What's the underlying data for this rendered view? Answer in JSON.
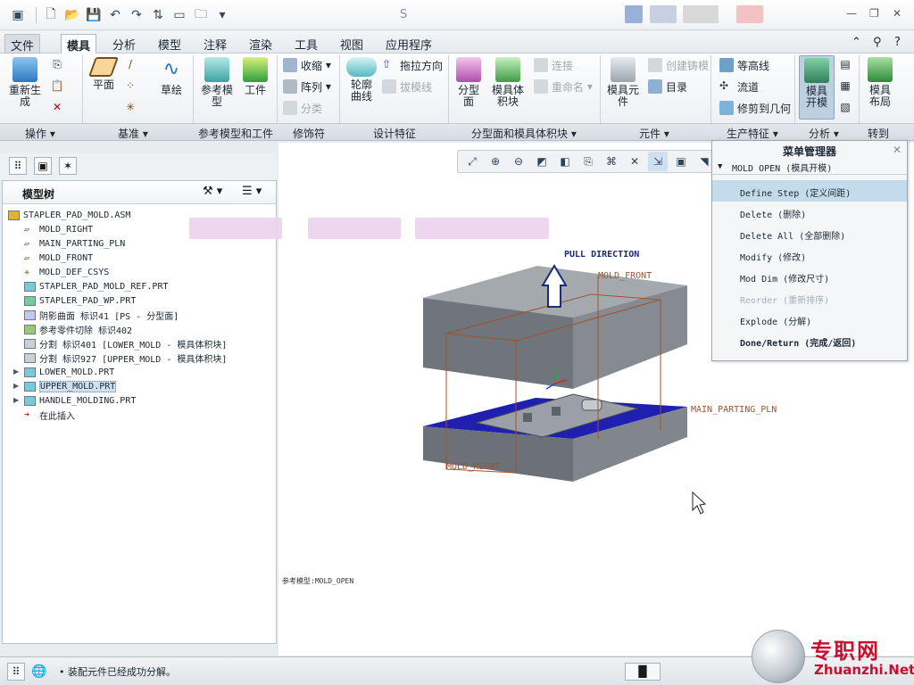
{
  "window": {
    "title_fragment": "S"
  },
  "menu_tabs": [
    "文件",
    "模具",
    "分析",
    "模型",
    "注释",
    "渲染",
    "工具",
    "视图",
    "应用程序"
  ],
  "active_tab": "模具",
  "ribbon": {
    "regenerate": "重新生\n成",
    "plane": "平面",
    "sketch": "草绘",
    "ref_model": "参考模\n型",
    "workpiece": "工件",
    "shrink": "收缩",
    "pattern": "阵列",
    "classify": "分类",
    "contour_curve": "轮廓\n曲线",
    "drag_direction": "拖拉方向",
    "draft_line": "拔模线",
    "parting_surface": "分型\n面",
    "mold_volume": "模具体\n积块",
    "connect": "连接",
    "rename": "重命名",
    "mold_component": "模具元\n件",
    "create_casting": "创建铸模",
    "catalog": "目录",
    "contour_line": "等高线",
    "flow": "流道",
    "trim_to_geom": "修剪到几何",
    "mold_open": "模具\n开模",
    "mold_layout": "模具\n布局"
  },
  "groups": [
    {
      "label": "操作"
    },
    {
      "label": "基准"
    },
    {
      "label": "参考模型和工件"
    },
    {
      "label": "修饰符"
    },
    {
      "label": "设计特征"
    },
    {
      "label": "分型面和模具体积块"
    },
    {
      "label": "元件"
    },
    {
      "label": "生产特征"
    },
    {
      "label": "分析"
    },
    {
      "label": "转到"
    }
  ],
  "tree": {
    "title": "模型树",
    "items": [
      {
        "label": "STAPLER_PAD_MOLD.ASM",
        "icon": "assembly-icon"
      },
      {
        "label": "MOLD_RIGHT",
        "icon": "datum-plane-icon"
      },
      {
        "label": "MAIN_PARTING_PLN",
        "icon": "datum-plane-icon"
      },
      {
        "label": "MOLD_FRONT",
        "icon": "datum-plane-icon"
      },
      {
        "label": "MOLD_DEF_CSYS",
        "icon": "csys-icon"
      },
      {
        "label": "STAPLER_PAD_MOLD_REF.PRT",
        "icon": "ref-part-icon"
      },
      {
        "label": "STAPLER_PAD_WP.PRT",
        "icon": "workpiece-icon"
      },
      {
        "label": "阴影曲面 标识41 [PS - 分型面]",
        "icon": "surface-icon"
      },
      {
        "label": "参考零件切除 标识402",
        "icon": "cut-icon"
      },
      {
        "label": "分割 标识401 [LOWER_MOLD - 模具体积块]",
        "icon": "split-icon"
      },
      {
        "label": "分割 标识927 [UPPER_MOLD - 模具体积块]",
        "icon": "split-icon"
      },
      {
        "label": "LOWER_MOLD.PRT",
        "icon": "part-icon"
      },
      {
        "label": "UPPER_MOLD.PRT",
        "icon": "part-icon"
      },
      {
        "label": "HANDLE_MOLDING.PRT",
        "icon": "part-icon"
      },
      {
        "label": "在此插入",
        "icon": "insert-arrow-icon"
      }
    ]
  },
  "viewport": {
    "pull_direction": "PULL DIRECTION",
    "mold_front": "MOLD_FRONT",
    "main_parting_pln": "MAIN_PARTING_PLN",
    "mold_right": "MOLD_RIGHT",
    "bottom_label": "参考模型:MOLD_OPEN"
  },
  "menu_manager": {
    "title": "菜单管理器",
    "submenu": "MOLD OPEN (模具开模)",
    "items": [
      {
        "label": "Define Step (定义间距)",
        "state": "highlight"
      },
      {
        "label": "Delete (删除)",
        "state": "normal"
      },
      {
        "label": "Delete All (全部删除)",
        "state": "normal"
      },
      {
        "label": "Modify (修改)",
        "state": "normal"
      },
      {
        "label": "Mod Dim (修改尺寸)",
        "state": "normal"
      },
      {
        "label": "Reorder (重新排序)",
        "state": "disabled"
      },
      {
        "label": "Explode (分解)",
        "state": "normal"
      },
      {
        "label": "Done/Return (完成/返回)",
        "state": "bold"
      }
    ]
  },
  "status": {
    "message": "• 装配元件已经成功分解。"
  },
  "watermark": {
    "cn": "专职网",
    "en": "Zhuanzhi.Net"
  },
  "colors": {
    "mold_grey": "#8a9096",
    "parting_blue": "#1f1fb0",
    "label_orange": "#a0522d",
    "label_blue": "#1a2a80",
    "accent_red": "#c8102e"
  }
}
